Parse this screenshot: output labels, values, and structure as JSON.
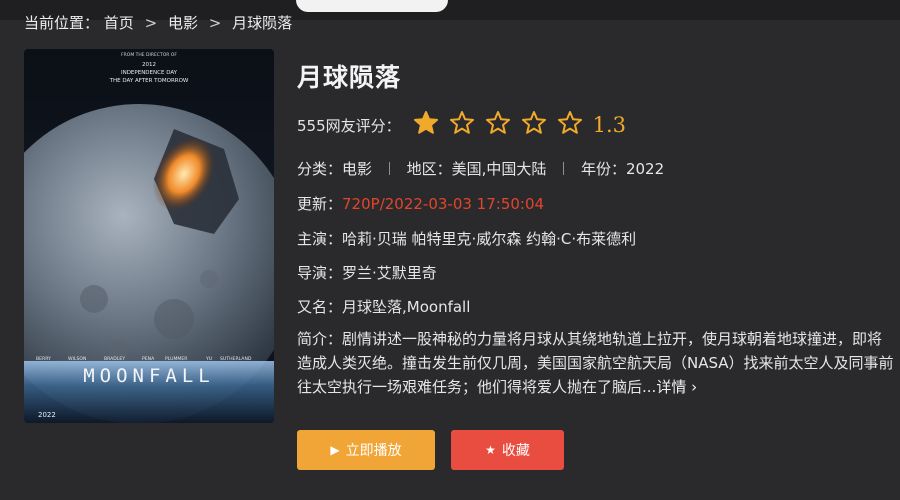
{
  "breadcrumb": {
    "prefix": "当前位置：",
    "items": [
      "首页",
      "电影",
      "月球陨落"
    ],
    "separator": ">"
  },
  "poster": {
    "director_line": "FROM THE DIRECTOR OF",
    "films": [
      "2012",
      "INDEPENDENCE DAY",
      "THE DAY AFTER TOMORROW"
    ],
    "cast": [
      "BERRY",
      "WILSON",
      "BRADLEY",
      "PENA",
      "PLUMMER",
      "YU",
      "SUTHERLAND"
    ],
    "logo_text": "MOONFALL",
    "year": "2022"
  },
  "movie": {
    "title": "月球陨落",
    "rating_label": "555网友评分：",
    "rating_score": "1.3",
    "stars_filled": 1,
    "stars_total": 5,
    "category_label": "分类：",
    "category": "电影",
    "region_label": "地区：",
    "region": "美国,中国大陆",
    "year_label": "年份：",
    "year": "2022",
    "update_label": "更新：",
    "update": "720P/2022-03-03 17:50:04",
    "cast_label": "主演：",
    "cast": "哈莉·贝瑞 帕特里克·威尔森 约翰·C·布莱德利",
    "director_label": "导演：",
    "director": "罗兰·艾默里奇",
    "alias_label": "又名：",
    "alias": "月球坠落,Moonfall",
    "summary_label": "简介：",
    "summary": "剧情讲述一股神秘的力量将月球从其绕地轨道上拉开，使月球朝着地球撞进，即将造成人类灭绝。撞击发生前仅几周，美国国家航空航天局（NASA）找来前太空人及同事前往太空执行一场艰难任务；他们得将爱人抛在了脑后...",
    "more_label": "详情 ›"
  },
  "buttons": {
    "play": "立即播放",
    "favorite": "收藏"
  },
  "colors": {
    "accent_star": "#f0a92a",
    "update_red": "#e2452a",
    "play_button": "#f0a536",
    "favorite_button": "#e84d3f"
  }
}
